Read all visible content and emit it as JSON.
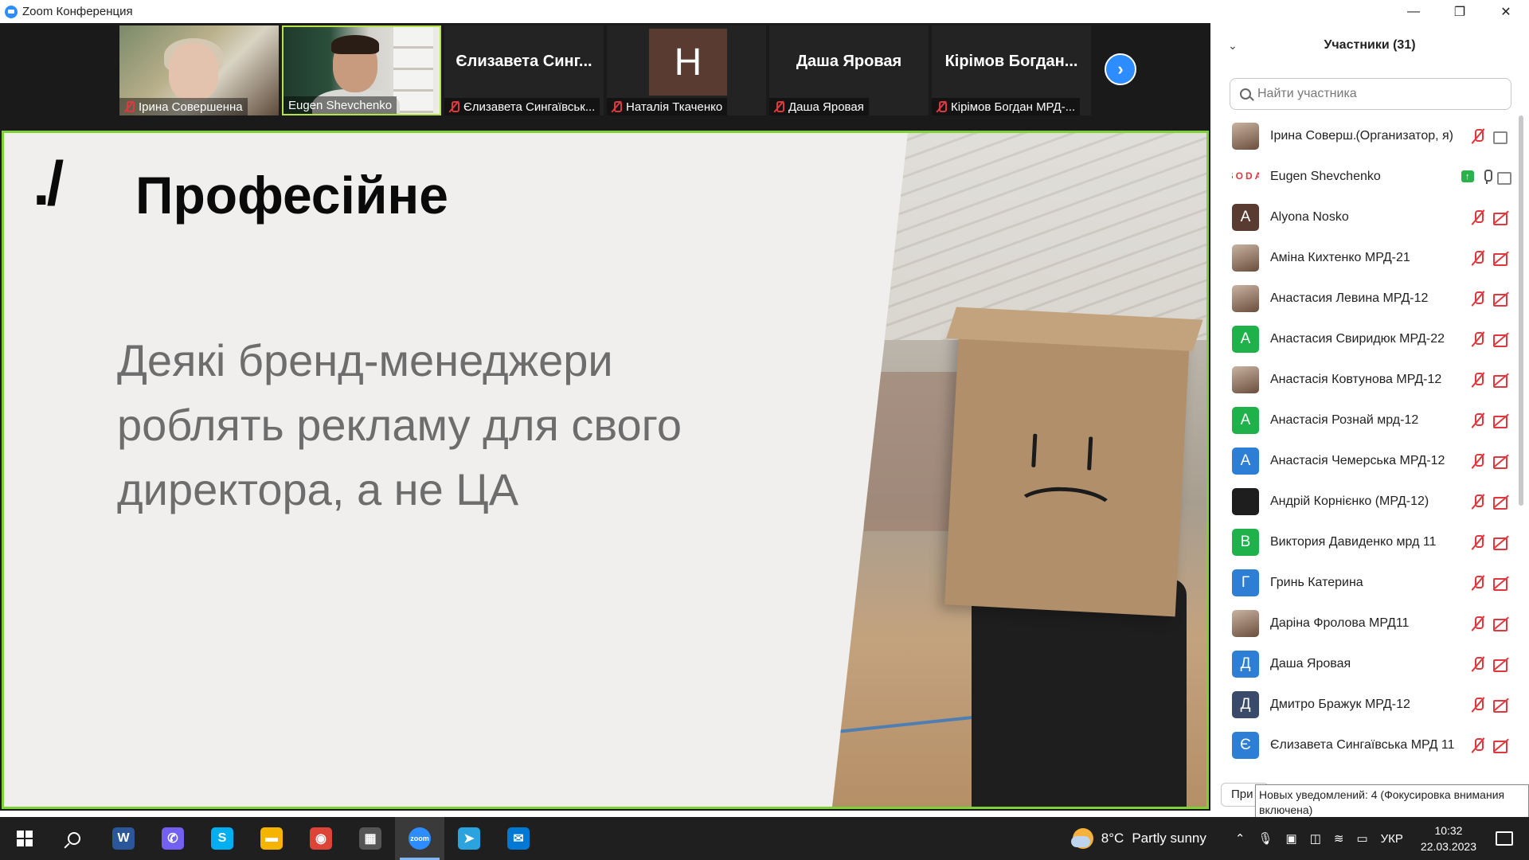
{
  "window": {
    "title": "Zoom Конференция",
    "minimize": "—",
    "restore": "❐",
    "close": "✕"
  },
  "video_strip": {
    "tiles": [
      {
        "name": "Ірина Совершенна",
        "muted": true,
        "type": "video"
      },
      {
        "name": "Eugen Shevchenko",
        "muted": false,
        "type": "video",
        "active": true
      },
      {
        "name": "Єлизавета Сингаївськ...",
        "big_name": "Єлизавета  Синг...",
        "muted": true,
        "type": "name"
      },
      {
        "name": "Наталія Ткаченко",
        "initial": "Н",
        "muted": true,
        "type": "avatar"
      },
      {
        "name": "Даша Яровая",
        "big_name": "Даша Яровая",
        "muted": true,
        "type": "name"
      },
      {
        "name": "Кірімов Богдан МРД-...",
        "big_name": "Кірімов  Богдан...",
        "muted": true,
        "type": "name"
      }
    ],
    "next_icon": "›"
  },
  "slide": {
    "logo": "./",
    "brand": "Професійне",
    "body": "Деякі бренд-менеджери роблять рекламу для свого директора, а не ЦА",
    "border_color": "#7fd13a"
  },
  "participants": {
    "title": "Участники (31)",
    "collapse_icon": "⌄",
    "search_placeholder": "Найти участника",
    "items": [
      {
        "name": "Ірина Соверш...",
        "role": "(Организатор, я)",
        "avatar": "photo",
        "audio": "muted",
        "video": "off-gray"
      },
      {
        "name": "Eugen Shevchenko",
        "role": "",
        "avatar": "soda",
        "avatar_text": "SODA",
        "audio": "on",
        "video": "off-gray",
        "sharing": true
      },
      {
        "name": "Alyona Nosko",
        "role": "",
        "avatar": "letter",
        "letter": "A",
        "color": "#5a3b31",
        "audio": "muted",
        "video": "off"
      },
      {
        "name": "Аміна Кихтенко МРД-21",
        "role": "",
        "avatar": "photo",
        "audio": "muted",
        "video": "off"
      },
      {
        "name": "Анастасия Левина МРД-12",
        "role": "",
        "avatar": "photo",
        "audio": "muted",
        "video": "off"
      },
      {
        "name": "Анастасия Свиридюк МРД-22",
        "role": "",
        "avatar": "letter",
        "letter": "А",
        "color": "#1fb14a",
        "audio": "muted",
        "video": "off"
      },
      {
        "name": "Анастасія Ковтунова МРД-12",
        "role": "",
        "avatar": "photo",
        "audio": "muted",
        "video": "off"
      },
      {
        "name": "Анастасія Рознай мрд-12",
        "role": "",
        "avatar": "letter",
        "letter": "А",
        "color": "#1fb14a",
        "audio": "muted",
        "video": "off"
      },
      {
        "name": "Анастасія Чемерська МРД-12",
        "role": "",
        "avatar": "letter",
        "letter": "А",
        "color": "#2d7fd6",
        "audio": "muted",
        "video": "off"
      },
      {
        "name": "Андрій Корнієнко (МРД-12)",
        "role": "",
        "avatar": "letter",
        "letter": "",
        "color": "#1e1e1e",
        "audio": "muted",
        "video": "off"
      },
      {
        "name": "Виктория Давиденко мрд 11",
        "role": "",
        "avatar": "letter",
        "letter": "В",
        "color": "#1fb14a",
        "audio": "muted",
        "video": "off"
      },
      {
        "name": "Гринь Катерина",
        "role": "",
        "avatar": "letter",
        "letter": "Г",
        "color": "#2d7fd6",
        "audio": "muted",
        "video": "off"
      },
      {
        "name": "Даріна Фролова МРД11",
        "role": "",
        "avatar": "photo",
        "audio": "muted",
        "video": "off"
      },
      {
        "name": "Даша Яровая",
        "role": "",
        "avatar": "letter",
        "letter": "Д",
        "color": "#2d7fd6",
        "audio": "muted",
        "video": "off"
      },
      {
        "name": "Дмитро Бражук МРД-12",
        "role": "",
        "avatar": "letter",
        "letter": "Д",
        "color": "#3a4a6a",
        "audio": "muted",
        "video": "off"
      },
      {
        "name": "Єлизавета Сингаївська МРД 11",
        "role": "",
        "avatar": "letter",
        "letter": "Є",
        "color": "#2d7fd6",
        "audio": "muted",
        "video": "off"
      }
    ],
    "bottom_button": "При"
  },
  "toast": {
    "text": "Новых уведомлений: 4 (Фокусировка внимания включена)"
  },
  "taskbar": {
    "apps": [
      {
        "name": "word",
        "label": "W",
        "color": "#2b579a"
      },
      {
        "name": "viber",
        "label": "✆",
        "color": "#7360f2"
      },
      {
        "name": "skype",
        "label": "S",
        "color": "#00aff0"
      },
      {
        "name": "explorer",
        "label": "▬",
        "color": "#f4b400"
      },
      {
        "name": "chrome",
        "label": "◉",
        "color": "#db4437"
      },
      {
        "name": "store",
        "label": "▦",
        "color": "#555"
      },
      {
        "name": "zoom",
        "label": "zoom",
        "color": "#2d8cff",
        "active": true
      },
      {
        "name": "telegram",
        "label": "➤",
        "color": "#2aa3df"
      },
      {
        "name": "mail",
        "label": "✉",
        "color": "#0078d4"
      }
    ],
    "weather_temp": "8°C",
    "weather_text": "Partly sunny",
    "tray_chevron": "⌃",
    "lang": "УКР",
    "time": "10:32",
    "date": "22.03.2023"
  }
}
